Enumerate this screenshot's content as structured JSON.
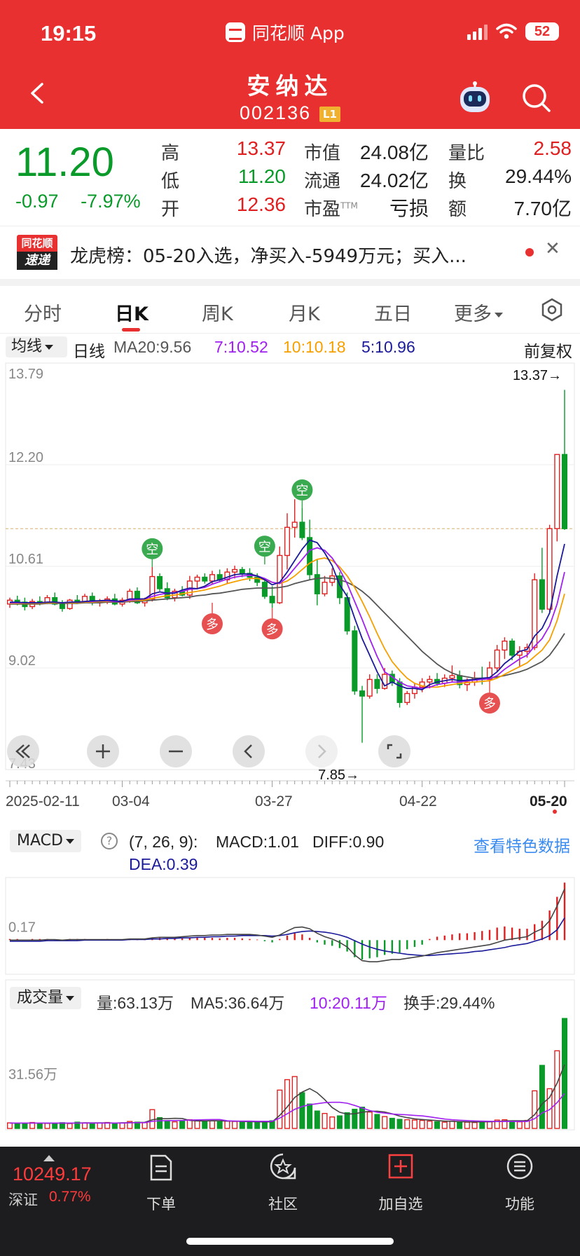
{
  "status_bar": {
    "time": "19:15",
    "app_name": "同花顺 App",
    "battery": "52"
  },
  "header": {
    "title": "安纳达",
    "code": "002136",
    "badge": "L1"
  },
  "quote": {
    "price": "11.20",
    "change": "-0.97",
    "change_pct": "-7.97%",
    "high_label": "高",
    "high": "13.37",
    "low_label": "低",
    "low": "11.20",
    "open_label": "开",
    "open": "12.36",
    "mktcap_label": "市值",
    "mktcap": "24.08亿",
    "float_label": "流通",
    "float": "24.02亿",
    "pe_label": "市盈",
    "pe_sup": "TTM",
    "pe": "亏损",
    "volratio_label": "量比",
    "volratio": "2.58",
    "turnover_label": "换",
    "turnover": "29.44%",
    "amount_label": "额",
    "amount": "7.70亿"
  },
  "news": {
    "logo_top": "同花顺",
    "logo_bottom": "速递",
    "text": "龙虎榜：05-20入选，净买入-5949万元；买入..."
  },
  "tabs": [
    "分时",
    "日K",
    "周K",
    "月K",
    "五日",
    "更多"
  ],
  "active_tab": "日K",
  "kline_header": {
    "indicator": "均线",
    "period": "日线",
    "ma20": "MA20:9.56",
    "ma7": "7:10.52",
    "ma10": "10:10.18",
    "ma5": "5:10.96",
    "adjust": "前复权"
  },
  "colors": {
    "brand_red": "#e93030",
    "up_red": "#e02020",
    "down_green": "#0a9a2a",
    "ma20": "#555555",
    "ma7": "#a020f0",
    "ma10": "#f5a000",
    "ma5": "#1a1a9a",
    "link_blue": "#3c8cf0"
  },
  "chart_data": [
    {
      "type": "candlestick",
      "ylim": [
        7.43,
        13.79
      ],
      "y_ticks": [
        "13.79",
        "12.20",
        "10.61",
        "9.02",
        "7.43"
      ],
      "x_labels": [
        "2025-02-11",
        "03-04",
        "03-27",
        "04-22",
        "05-20"
      ],
      "max_marker": "13.37→",
      "min_marker": "7.85→",
      "reference_line": 11.2,
      "signal_short": "空",
      "signal_long": "多",
      "candles": [
        [
          10.02,
          10.12,
          9.96,
          10.08
        ],
        [
          10.08,
          10.15,
          10.0,
          10.05
        ],
        [
          10.05,
          10.12,
          9.92,
          9.98
        ],
        [
          9.98,
          10.1,
          9.94,
          10.06
        ],
        [
          10.06,
          10.14,
          10.0,
          10.04
        ],
        [
          10.04,
          10.16,
          10.02,
          10.12
        ],
        [
          10.12,
          10.2,
          10.0,
          10.02
        ],
        [
          10.02,
          10.08,
          9.9,
          9.95
        ],
        [
          9.95,
          10.1,
          9.93,
          10.08
        ],
        [
          10.08,
          10.16,
          10.02,
          10.06
        ],
        [
          10.06,
          10.18,
          10.04,
          10.14
        ],
        [
          10.14,
          10.2,
          10.0,
          10.04
        ],
        [
          10.04,
          10.1,
          9.98,
          10.06
        ],
        [
          10.06,
          10.14,
          10.02,
          10.1
        ],
        [
          10.1,
          10.18,
          10.0,
          10.02
        ],
        [
          10.02,
          10.12,
          9.98,
          10.08
        ],
        [
          10.08,
          10.26,
          10.04,
          10.22
        ],
        [
          10.22,
          10.28,
          10.02,
          10.04
        ],
        [
          10.04,
          10.12,
          9.98,
          10.1
        ],
        [
          10.1,
          10.6,
          10.06,
          10.45
        ],
        [
          10.45,
          10.5,
          10.22,
          10.26
        ],
        [
          10.26,
          10.36,
          10.08,
          10.12
        ],
        [
          10.12,
          10.26,
          10.06,
          10.22
        ],
        [
          10.22,
          10.3,
          10.14,
          10.16
        ],
        [
          10.16,
          10.46,
          10.1,
          10.38
        ],
        [
          10.38,
          10.48,
          10.26,
          10.44
        ],
        [
          10.44,
          10.5,
          10.34,
          10.38
        ],
        [
          10.38,
          10.54,
          10.32,
          10.48
        ],
        [
          10.48,
          10.56,
          10.36,
          10.4
        ],
        [
          10.4,
          10.58,
          10.34,
          10.52
        ],
        [
          10.52,
          10.62,
          10.42,
          10.56
        ],
        [
          10.56,
          10.6,
          10.44,
          10.5
        ],
        [
          10.5,
          10.58,
          10.38,
          10.44
        ],
        [
          10.44,
          10.5,
          10.3,
          10.36
        ],
        [
          10.36,
          10.42,
          10.1,
          10.14
        ],
        [
          10.14,
          10.3,
          9.96,
          10.04
        ],
        [
          10.04,
          10.92,
          10.02,
          10.78
        ],
        [
          10.78,
          11.44,
          10.56,
          11.22
        ],
        [
          11.22,
          11.66,
          11.06,
          11.3
        ],
        [
          11.3,
          11.52,
          11.02,
          11.06
        ],
        [
          11.06,
          11.34,
          10.4,
          10.48
        ],
        [
          10.48,
          10.72,
          10.0,
          10.18
        ],
        [
          10.18,
          10.46,
          10.14,
          10.36
        ],
        [
          10.36,
          10.58,
          10.3,
          10.46
        ],
        [
          10.46,
          10.52,
          10.02,
          10.12
        ],
        [
          10.12,
          10.2,
          9.54,
          9.6
        ],
        [
          9.6,
          9.68,
          8.6,
          8.66
        ],
        [
          8.66,
          8.74,
          7.85,
          8.58
        ],
        [
          8.58,
          8.92,
          8.54,
          8.84
        ],
        [
          8.84,
          8.92,
          8.62,
          8.7
        ],
        [
          8.7,
          9.02,
          8.68,
          8.92
        ],
        [
          8.92,
          8.98,
          8.74,
          8.8
        ],
        [
          8.8,
          8.86,
          8.4,
          8.48
        ],
        [
          8.48,
          8.66,
          8.44,
          8.62
        ],
        [
          8.62,
          8.78,
          8.54,
          8.72
        ],
        [
          8.72,
          8.86,
          8.64,
          8.8
        ],
        [
          8.8,
          8.9,
          8.7,
          8.84
        ],
        [
          8.84,
          8.94,
          8.74,
          8.78
        ],
        [
          8.78,
          8.92,
          8.72,
          8.86
        ],
        [
          8.86,
          9.06,
          8.8,
          8.9
        ],
        [
          8.9,
          8.98,
          8.7,
          8.76
        ],
        [
          8.76,
          8.86,
          8.66,
          8.8
        ],
        [
          8.8,
          8.96,
          8.74,
          8.86
        ],
        [
          8.86,
          9.04,
          8.76,
          8.84
        ],
        [
          8.84,
          9.12,
          8.8,
          9.02
        ],
        [
          9.02,
          9.38,
          8.96,
          9.3
        ],
        [
          9.3,
          9.5,
          9.16,
          9.44
        ],
        [
          9.44,
          9.48,
          9.14,
          9.22
        ],
        [
          9.22,
          9.36,
          9.04,
          9.28
        ],
        [
          9.28,
          9.4,
          9.18,
          9.34
        ],
        [
          9.34,
          10.5,
          9.3,
          10.4
        ],
        [
          10.4,
          10.9,
          9.88,
          9.94
        ],
        [
          9.94,
          11.26,
          9.9,
          11.2
        ],
        [
          11.2,
          12.36,
          11.0,
          12.36
        ],
        [
          12.36,
          13.37,
          11.18,
          11.2
        ]
      ],
      "ma5": [
        10.05,
        10.05,
        10.04,
        10.04,
        10.04,
        10.05,
        10.05,
        10.04,
        10.05,
        10.05,
        10.06,
        10.07,
        10.07,
        10.08,
        10.07,
        10.06,
        10.1,
        10.1,
        10.1,
        10.18,
        10.21,
        10.19,
        10.19,
        10.24,
        10.27,
        10.26,
        10.3,
        10.37,
        10.4,
        10.44,
        10.48,
        10.49,
        10.49,
        10.46,
        10.4,
        10.32,
        10.36,
        10.52,
        10.7,
        10.88,
        11.02,
        10.98,
        10.82,
        10.62,
        10.32,
        10.14,
        9.8,
        9.48,
        9.22,
        8.96,
        8.74,
        8.8,
        8.74,
        8.7,
        8.7,
        8.68,
        8.76,
        8.8,
        8.82,
        8.84,
        8.82,
        8.83,
        8.84,
        8.86,
        8.87,
        8.96,
        9.09,
        9.18,
        9.28,
        9.31,
        9.52,
        9.64,
        9.88,
        10.46,
        10.96
      ],
      "ma7": [
        10.04,
        10.04,
        10.04,
        10.04,
        10.04,
        10.05,
        10.05,
        10.04,
        10.05,
        10.05,
        10.06,
        10.06,
        10.07,
        10.07,
        10.06,
        10.06,
        10.08,
        10.09,
        10.1,
        10.14,
        10.17,
        10.19,
        10.2,
        10.22,
        10.25,
        10.26,
        10.28,
        10.33,
        10.37,
        10.41,
        10.44,
        10.46,
        10.47,
        10.46,
        10.42,
        10.36,
        10.34,
        10.44,
        10.58,
        10.72,
        10.86,
        10.9,
        10.86,
        10.74,
        10.56,
        10.34,
        10.06,
        9.78,
        9.48,
        9.2,
        8.96,
        8.88,
        8.8,
        8.74,
        8.72,
        8.7,
        8.72,
        8.76,
        8.78,
        8.8,
        8.8,
        8.82,
        8.83,
        8.84,
        8.85,
        8.9,
        9.0,
        9.08,
        9.16,
        9.22,
        9.36,
        9.48,
        9.68,
        10.02,
        10.52
      ],
      "ma10": [
        10.03,
        10.03,
        10.03,
        10.03,
        10.03,
        10.04,
        10.04,
        10.04,
        10.04,
        10.04,
        10.05,
        10.05,
        10.06,
        10.06,
        10.06,
        10.06,
        10.07,
        10.08,
        10.08,
        10.11,
        10.13,
        10.15,
        10.16,
        10.18,
        10.2,
        10.22,
        10.24,
        10.27,
        10.3,
        10.34,
        10.37,
        10.4,
        10.42,
        10.42,
        10.4,
        10.36,
        10.34,
        10.38,
        10.46,
        10.56,
        10.66,
        10.72,
        10.74,
        10.7,
        10.6,
        10.46,
        10.28,
        10.06,
        9.82,
        9.56,
        9.32,
        9.12,
        8.98,
        8.86,
        8.78,
        8.74,
        8.72,
        8.72,
        8.74,
        8.76,
        8.78,
        8.79,
        8.8,
        8.81,
        8.82,
        8.86,
        8.92,
        8.98,
        9.04,
        9.1,
        9.2,
        9.3,
        9.46,
        9.76,
        10.18
      ],
      "ma20": [
        10.02,
        10.02,
        10.02,
        10.02,
        10.02,
        10.03,
        10.03,
        10.03,
        10.03,
        10.03,
        10.04,
        10.04,
        10.04,
        10.05,
        10.05,
        10.05,
        10.06,
        10.06,
        10.07,
        10.08,
        10.09,
        10.1,
        10.11,
        10.12,
        10.13,
        10.15,
        10.16,
        10.18,
        10.19,
        10.21,
        10.23,
        10.25,
        10.26,
        10.27,
        10.27,
        10.27,
        10.28,
        10.3,
        10.34,
        10.37,
        10.4,
        10.42,
        10.43,
        10.42,
        10.4,
        10.36,
        10.3,
        10.22,
        10.12,
        10.0,
        9.88,
        9.76,
        9.64,
        9.52,
        9.4,
        9.28,
        9.18,
        9.08,
        9.0,
        8.94,
        8.9,
        8.88,
        8.86,
        8.86,
        8.86,
        8.88,
        8.9,
        8.93,
        8.96,
        9.0,
        9.06,
        9.12,
        9.22,
        9.38,
        9.56
      ]
    },
    {
      "type": "bar",
      "name": "MACD",
      "params": "(7, 26, 9):",
      "macd_label": "MACD:1.01",
      "diff_label": "DIFF:0.90",
      "dea_label": "DEA:0.39",
      "y_tick": "0.17",
      "link": "查看特色数据",
      "values": [
        0.02,
        0.02,
        0.01,
        0.02,
        0.02,
        0.02,
        0.01,
        0.01,
        0.02,
        0.02,
        0.02,
        0.01,
        0.01,
        0.02,
        0.01,
        0.01,
        0.02,
        0.02,
        0.01,
        0.04,
        0.04,
        0.03,
        0.03,
        0.03,
        0.04,
        0.04,
        0.04,
        0.04,
        0.03,
        0.04,
        0.04,
        0.03,
        0.02,
        0.01,
        -0.02,
        -0.04,
        0.02,
        0.08,
        0.12,
        0.1,
        0.04,
        -0.04,
        -0.08,
        -0.1,
        -0.14,
        -0.2,
        -0.3,
        -0.34,
        -0.32,
        -0.3,
        -0.26,
        -0.24,
        -0.22,
        -0.16,
        -0.12,
        -0.08,
        0.02,
        0.06,
        0.08,
        0.1,
        0.12,
        0.12,
        0.14,
        0.16,
        0.18,
        0.22,
        0.24,
        0.22,
        0.2,
        0.2,
        0.28,
        0.34,
        0.52,
        0.76,
        1.01
      ],
      "diff": [
        0.0,
        0.0,
        0.0,
        0.0,
        0.0,
        0.01,
        0.01,
        0.0,
        0.01,
        0.01,
        0.01,
        0.01,
        0.01,
        0.01,
        0.01,
        0.01,
        0.02,
        0.02,
        0.02,
        0.04,
        0.05,
        0.05,
        0.05,
        0.06,
        0.07,
        0.08,
        0.08,
        0.09,
        0.09,
        0.1,
        0.1,
        0.1,
        0.1,
        0.09,
        0.07,
        0.05,
        0.09,
        0.16,
        0.22,
        0.23,
        0.2,
        0.12,
        0.06,
        0.02,
        -0.04,
        -0.12,
        -0.26,
        -0.36,
        -0.38,
        -0.38,
        -0.36,
        -0.34,
        -0.34,
        -0.32,
        -0.3,
        -0.28,
        -0.25,
        -0.22,
        -0.2,
        -0.18,
        -0.16,
        -0.14,
        -0.12,
        -0.1,
        -0.08,
        -0.04,
        0.0,
        0.02,
        0.04,
        0.06,
        0.14,
        0.2,
        0.34,
        0.6,
        0.9
      ],
      "dea": [
        -0.02,
        -0.02,
        -0.02,
        -0.02,
        -0.02,
        -0.01,
        -0.01,
        -0.01,
        -0.01,
        -0.01,
        0.0,
        0.0,
        0.0,
        0.0,
        0.0,
        0.0,
        0.01,
        0.01,
        0.01,
        0.02,
        0.02,
        0.03,
        0.03,
        0.04,
        0.04,
        0.05,
        0.05,
        0.06,
        0.06,
        0.07,
        0.07,
        0.08,
        0.08,
        0.08,
        0.08,
        0.07,
        0.08,
        0.1,
        0.13,
        0.15,
        0.16,
        0.15,
        0.14,
        0.12,
        0.09,
        0.05,
        -0.01,
        -0.07,
        -0.12,
        -0.16,
        -0.19,
        -0.21,
        -0.23,
        -0.25,
        -0.26,
        -0.27,
        -0.27,
        -0.26,
        -0.25,
        -0.24,
        -0.23,
        -0.22,
        -0.2,
        -0.19,
        -0.17,
        -0.15,
        -0.13,
        -0.1,
        -0.08,
        -0.06,
        -0.02,
        0.02,
        0.08,
        0.18,
        0.39
      ]
    },
    {
      "type": "bar",
      "name": "成交量",
      "vol_label": "量:63.13万",
      "ma5_label": "MA5:36.64万",
      "ma10_label": "10:20.11万",
      "turnover_label": "换手:29.44%",
      "y_tick": "31.56万",
      "values": [
        3.2,
        3.0,
        2.8,
        3.4,
        3.1,
        2.9,
        3.0,
        3.3,
        2.8,
        3.6,
        3.2,
        3.0,
        3.1,
        3.4,
        3.0,
        3.2,
        4.0,
        3.6,
        3.3,
        10.8,
        6.2,
        4.0,
        3.8,
        4.2,
        5.0,
        4.6,
        4.0,
        4.4,
        3.8,
        4.2,
        4.0,
        3.6,
        3.6,
        3.4,
        3.8,
        4.4,
        22.0,
        28.0,
        29.8,
        20.5,
        14.0,
        10.0,
        8.6,
        6.6,
        7.2,
        9.0,
        11.0,
        12.2,
        9.4,
        8.0,
        6.8,
        5.8,
        5.2,
        5.0,
        4.8,
        4.6,
        4.2,
        3.8,
        3.6,
        4.2,
        3.8,
        3.6,
        3.4,
        3.8,
        4.0,
        4.8,
        5.0,
        4.2,
        3.8,
        4.6,
        21.6,
        36.2,
        22.8,
        44.6,
        63.13
      ],
      "ma5": [
        3.1,
        3.1,
        3.1,
        3.1,
        3.1,
        3.0,
        3.0,
        3.1,
        3.0,
        3.1,
        3.2,
        3.2,
        3.2,
        3.2,
        3.1,
        3.2,
        3.3,
        3.4,
        3.5,
        5.0,
        5.6,
        5.6,
        5.8,
        5.7,
        4.6,
        4.3,
        4.3,
        4.4,
        4.4,
        4.2,
        4.2,
        4.0,
        3.9,
        3.8,
        3.7,
        3.8,
        7.5,
        12.3,
        17.8,
        20.9,
        22.9,
        20.5,
        16.6,
        12.0,
        9.3,
        8.2,
        8.4,
        9.3,
        9.8,
        9.9,
        9.4,
        8.4,
        7.1,
        6.2,
        5.5,
        5.1,
        4.8,
        4.5,
        4.2,
        4.1,
        3.9,
        3.8,
        3.7,
        3.8,
        3.8,
        4.0,
        4.3,
        4.4,
        4.4,
        4.4,
        7.9,
        14.1,
        17.8,
        26.0,
        36.64
      ],
      "ma10": [
        3.1,
        3.1,
        3.1,
        3.1,
        3.1,
        3.1,
        3.1,
        3.1,
        3.1,
        3.1,
        3.1,
        3.1,
        3.1,
        3.1,
        3.1,
        3.1,
        3.2,
        3.3,
        3.3,
        4.1,
        4.4,
        4.5,
        4.5,
        4.6,
        4.8,
        4.9,
        5.0,
        5.1,
        5.1,
        4.4,
        4.2,
        4.2,
        4.2,
        4.1,
        4.1,
        4.1,
        5.9,
        8.4,
        11.0,
        12.6,
        13.6,
        14.2,
        14.8,
        15.0,
        15.0,
        14.5,
        13.2,
        11.8,
        10.3,
        9.3,
        8.8,
        8.3,
        8.0,
        7.8,
        7.5,
        7.2,
        6.7,
        6.0,
        5.4,
        5.0,
        4.7,
        4.5,
        4.3,
        4.2,
        4.1,
        4.0,
        4.0,
        4.0,
        4.0,
        4.0,
        5.6,
        8.9,
        10.8,
        14.8,
        20.11
      ]
    }
  ],
  "bottom_nav": {
    "index_value": "10249.17",
    "index_name": "深证",
    "index_pct": "0.77%",
    "items": [
      "下单",
      "社区",
      "加自选",
      "功能"
    ]
  }
}
